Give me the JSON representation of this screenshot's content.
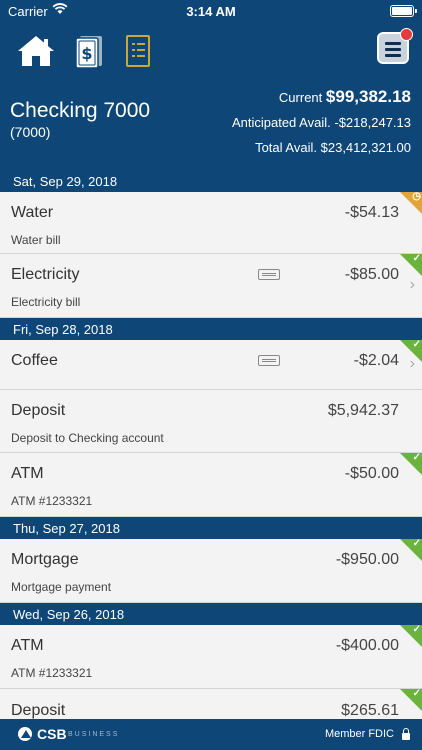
{
  "status": {
    "carrier": "Carrier",
    "time": "3:14 AM"
  },
  "header": {
    "account_name": "Checking 7000",
    "account_number": "(7000)",
    "current_label": "Current",
    "current_value": "$99,382.18",
    "anticipated_label": "Anticipated Avail.",
    "anticipated_value": "-$218,247.13",
    "total_label": "Total Avail.",
    "total_value": "$23,412,321.00"
  },
  "icons": {
    "home": "home-icon",
    "money": "money-icon",
    "statement": "statement-icon",
    "menu": "menu-icon"
  },
  "dates": [
    "Sat, Sep 29, 2018",
    "Fri, Sep 28, 2018",
    "Thu, Sep 27, 2018",
    "Wed, Sep 26, 2018"
  ],
  "transactions": [
    {
      "title": "Water",
      "amount": "-$54.13",
      "desc": "Water bill",
      "status": "pending"
    },
    {
      "title": "Electricity",
      "amount": "-$85.00",
      "desc": "Electricity bill",
      "status": "cleared"
    },
    {
      "title": "Coffee",
      "amount": "-$2.04",
      "desc": "",
      "status": "cleared"
    },
    {
      "title": "Deposit",
      "amount": "$5,942.37",
      "desc": "Deposit to Checking account",
      "status": "none"
    },
    {
      "title": "ATM",
      "amount": "-$50.00",
      "desc": "ATM #1233321",
      "status": "cleared"
    },
    {
      "title": "Mortgage",
      "amount": "-$950.00",
      "desc": "Mortgage payment",
      "status": "cleared"
    },
    {
      "title": "ATM",
      "amount": "-$400.00",
      "desc": "ATM #1233321",
      "status": "cleared"
    },
    {
      "title": "Deposit",
      "amount": "$265.61",
      "desc": "",
      "status": "cleared"
    }
  ],
  "footer": {
    "brand": "CSB",
    "brand_sub": "BUSINESS",
    "fdic": "Member FDIC"
  },
  "colors": {
    "navy": "#0e4677",
    "cleared": "#6ab43e",
    "pending": "#e0a53b",
    "alert": "#e23b3b"
  }
}
